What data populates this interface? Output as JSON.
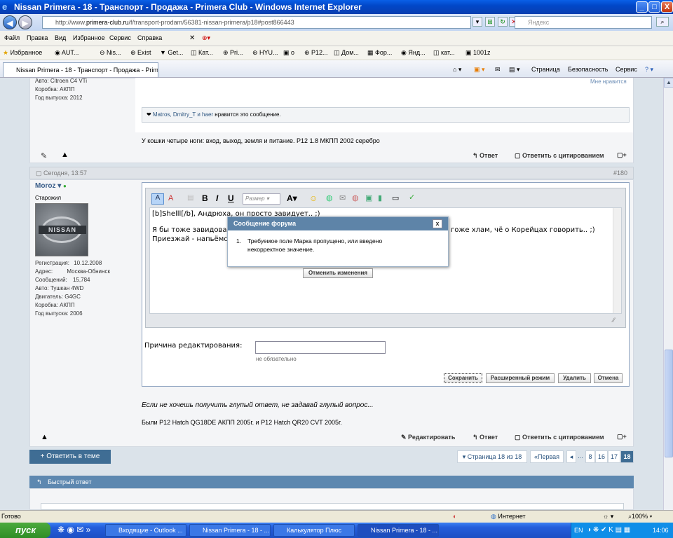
{
  "window": {
    "title": "Nissan Primera - 18 - Транспорт - Продажа - Primera Club - Windows Internet Explorer",
    "min_label": "_",
    "max_label": "□",
    "close_label": "X"
  },
  "address": {
    "prefix": "http://www.",
    "host": "primera-club.ru",
    "path": "/f/transport-prodam/56381-nissan-primera/p18#post866443"
  },
  "search": {
    "placeholder": "Яндекс"
  },
  "menu": [
    "Файл",
    "Правка",
    "Вид",
    "Избранное",
    "Сервис",
    "Справка"
  ],
  "favorites": {
    "label": "Избранное",
    "items": [
      "AUT...",
      "Nis...",
      "Exist",
      "Get...",
      "Кат...",
      "Pri...",
      "HYU...",
      "о",
      "P12...",
      "Дом...",
      "Фор...",
      "Янд...",
      "кат...",
      "1001z"
    ]
  },
  "tab": {
    "title": "Nissan Primera - 18 - Транспорт - Продажа - Primera..."
  },
  "ie_tools": [
    "Страница",
    "Безопасность",
    "Сервис"
  ],
  "post_prev": {
    "user_lines": [
      "Авто: Citroen C4 VTi",
      "Коробка: АКПП",
      "Год выпуска: 2012"
    ],
    "likes_link": "Мне нравится",
    "like_users": "Matros, Dmitry_T и haer",
    "like_suffix": "нравится это сообщение.",
    "signature": "У кошки четыре ноги: вход, выход, земля и питание. P12 1.8 МКПП 2002 серебро",
    "reply": "Ответ",
    "quote": "Ответить с цитированием"
  },
  "post": {
    "date": "Сегодня, 13:57",
    "number": "#180",
    "username": "Moroz",
    "usertitle": "Старожил",
    "stats": [
      [
        "Регистрация:",
        "10.12.2008"
      ],
      [
        "Адрес:",
        "Москва-Обнинск"
      ],
      [
        "Сообщений:",
        "15,784"
      ]
    ],
    "stats2": [
      "Авто: Тушкан 4WD",
      "Двигатель: G4GC",
      "Коробка: АКПП",
      "Год выпуска: 2006"
    ],
    "size_placeholder": "Размер",
    "editor_lines": [
      "[b]Shelll[/b], Андрюха, он просто завидует.. ;)",
      "Я бы тоже завидовал",
      "гоже хлам, чё о Корейцах говорить.. ;)",
      "Приезжай - напьёмся"
    ],
    "reason_label": "Причина редактирования:",
    "reason_hint": "не обязательно",
    "btn_save": "Сохранить",
    "btn_advanced": "Расширенный режим",
    "btn_delete": "Удалить",
    "btn_cancel": "Отмена",
    "signature1": "Если не хочешь получить глупый ответ, не задавай глупый вопрос...",
    "signature2": "Были P12 Hatch QG18DE АКПП 2005г. и P12 Hatch QR20 CVT 2005г.",
    "edit": "Редактировать",
    "reply": "Ответ",
    "quote": "Ответить с цитированием"
  },
  "dialog": {
    "title": "Сообщение форума",
    "close": "x",
    "num": "1.",
    "message_line1": "Требуемое поле Марка пропущено, или введено",
    "message_line2": "некорректное значение.",
    "revert": "Отменить изменения"
  },
  "reply_button": "+ Ответить в теме",
  "pagination": {
    "label": "▾ Страница 18 из 18",
    "first": "«Первая",
    "prev": "◂",
    "ellipsis": "...",
    "pages": [
      "8",
      "16",
      "17",
      "18"
    ]
  },
  "quick_reply": "Быстрый ответ",
  "status": {
    "left": "Готово",
    "zone": "Интернет",
    "zoom": "100%"
  },
  "taskbar": {
    "start": "пуск",
    "tasks": [
      "Входящие - Outlook ...",
      "Nissan Primera - 18 - ...",
      "Калькулятор Плюс",
      "Nissan Primera - 18 - ..."
    ],
    "lang": "EN",
    "clock": "14:06"
  }
}
